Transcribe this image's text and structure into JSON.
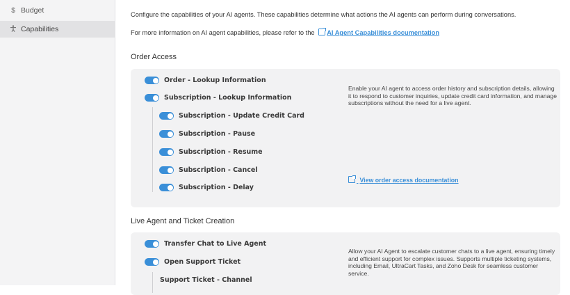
{
  "sidebar": {
    "items": [
      {
        "icon": "dollar-icon",
        "label": "Budget",
        "active": false
      },
      {
        "icon": "figure-icon",
        "label": "Capabilities",
        "active": true
      }
    ]
  },
  "main": {
    "intro": "Configure the capabilities of your AI agents. These capabilities determine what actions the AI agents can perform during conversations.",
    "more_info": "For more information on AI agent capabilities, please refer to the",
    "doc_link": "AI Agent Capabilities documentation",
    "sections": [
      {
        "title": "Order Access",
        "items": [
          {
            "label": "Order - Lookup Information",
            "enabled": true,
            "level": 0
          },
          {
            "label": "Subscription - Lookup Information",
            "enabled": true,
            "level": 0
          },
          {
            "label": "Subscription - Update Credit Card",
            "enabled": true,
            "level": 1
          },
          {
            "label": "Subscription - Pause",
            "enabled": true,
            "level": 1
          },
          {
            "label": "Subscription - Resume",
            "enabled": true,
            "level": 1
          },
          {
            "label": "Subscription - Cancel",
            "enabled": true,
            "level": 1
          },
          {
            "label": "Subscription - Delay",
            "enabled": true,
            "level": 1
          }
        ],
        "description": "Enable your AI agent to access order history and subscription details, allowing it to respond to customer inquiries, update credit card information, and manage subscriptions without the need for a live agent.",
        "link": "View order access documentation"
      },
      {
        "title": "Live Agent and Ticket Creation",
        "items": [
          {
            "label": "Transfer Chat to Live Agent",
            "enabled": true,
            "level": 0
          },
          {
            "label": "Open Support Ticket",
            "enabled": true,
            "level": 0
          },
          {
            "label": "Support Ticket - Channel",
            "enabled": null,
            "level": 1
          }
        ],
        "description": "Allow your AI Agent to escalate customer chats to a live agent, ensuring timely and efficient support for complex issues. Supports multiple ticketing systems, including Email, UltraCart Tasks, and Zoho Desk for seamless customer service."
      }
    ]
  },
  "colors": {
    "accent": "#3a8fd8",
    "panel": "#f2f2f3",
    "sidebar": "#f4f4f5"
  }
}
